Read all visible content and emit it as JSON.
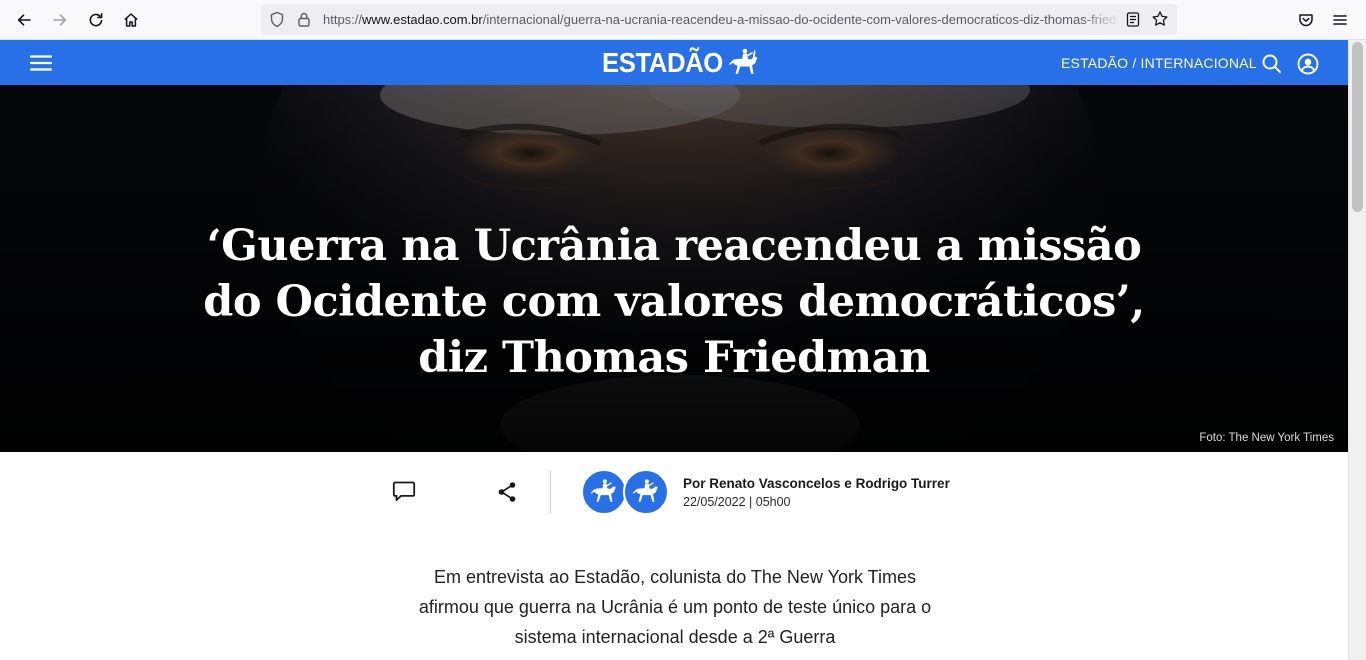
{
  "browser": {
    "url_scheme": "https://",
    "url_host": "www.estadao.com.br",
    "url_path": "/internacional/guerra-na-ucrania-reacendeu-a-missao-do-ocidente-com-valores-democraticos-diz-thomas-friedman"
  },
  "header": {
    "logo": "ESTADÃO",
    "section": "ESTADÃO / INTERNACIONAL",
    "accent_color": "#2770e8"
  },
  "hero": {
    "title": "‘Guerra na Ucrânia reacendeu a missão do Ocidente com valores democráticos’, diz Thomas Friedman",
    "photo_credit": "Foto: The New York Times"
  },
  "meta": {
    "byline": "Por Renato Vasconcelos e Rodrigo Turrer",
    "date": "22/05/2022 | 05h00"
  },
  "article": {
    "subtitle": "Em entrevista ao Estadão, colunista do The New York Times afirmou que guerra na Ucrânia é um ponto de teste único para o sistema internacional desde a 2ª Guerra"
  },
  "icons": {
    "back": "arrow-left-icon",
    "forward": "arrow-right-icon",
    "reload": "reload-icon",
    "home": "home-icon",
    "tracking": "shield-icon",
    "secure": "lock-icon",
    "reader": "reader-view-icon",
    "bookmark": "star-icon",
    "pocket": "pocket-icon",
    "app_menu": "menu-icon",
    "site_menu": "hamburger-icon",
    "search": "search-icon",
    "account": "user-icon",
    "comment": "comment-icon",
    "share": "share-icon"
  }
}
